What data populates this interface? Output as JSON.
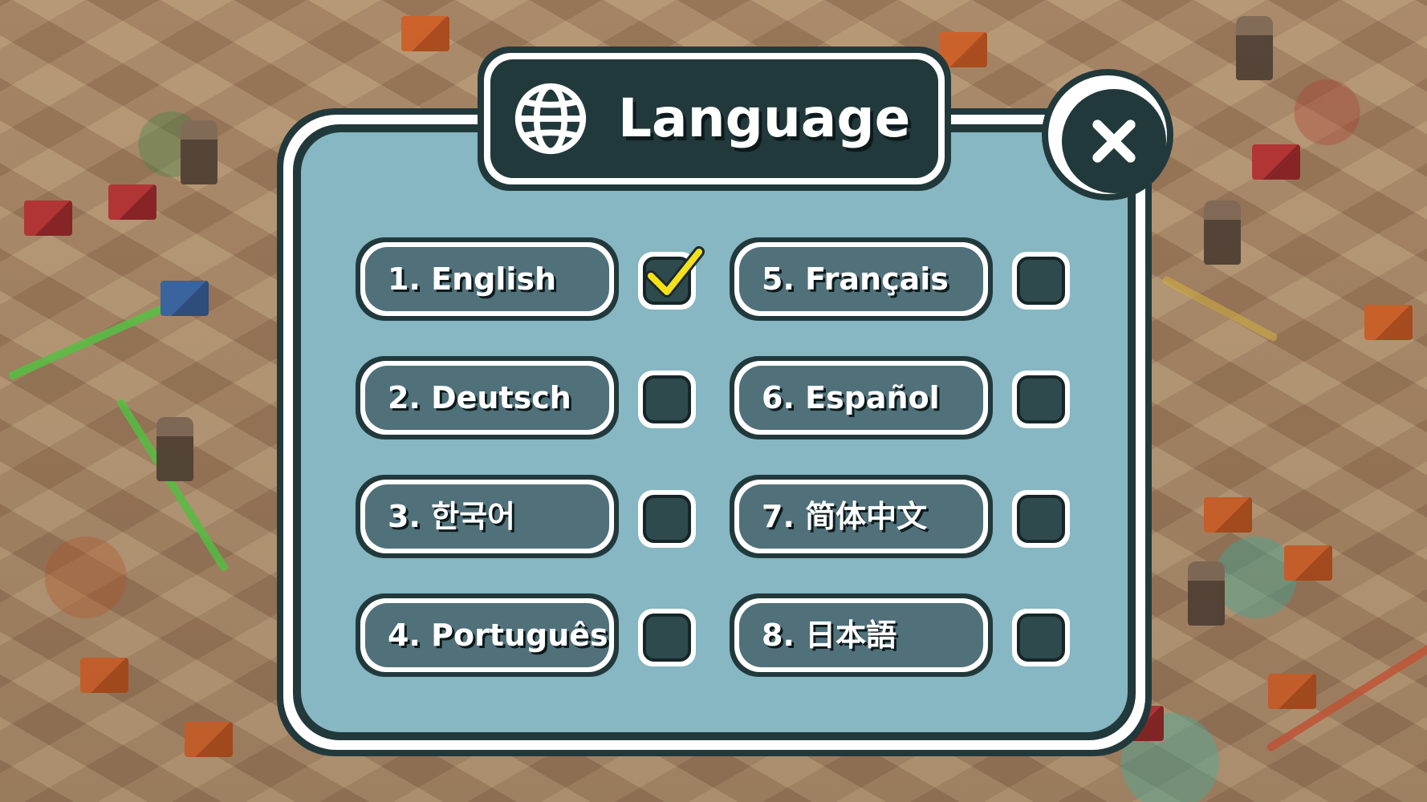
{
  "dialog": {
    "title": "Language",
    "title_icon": "globe-icon",
    "close_icon": "close-icon"
  },
  "languages": [
    {
      "label": "1. English",
      "checked": true
    },
    {
      "label": "2. Deutsch",
      "checked": false
    },
    {
      "label": "3. 한국어",
      "checked": false
    },
    {
      "label": "4. Português",
      "checked": false
    },
    {
      "label": "5. Français",
      "checked": false
    },
    {
      "label": "6. Español",
      "checked": false
    },
    {
      "label": "7. 简体中文",
      "checked": false
    },
    {
      "label": "8. 日本語",
      "checked": false
    }
  ],
  "colors": {
    "panel_dark": "#22393c",
    "panel_fill": "#86b7c2",
    "option_fill": "#50707a",
    "checkbox_fill": "#2f4a4d",
    "check_color": "#f5e11a"
  }
}
